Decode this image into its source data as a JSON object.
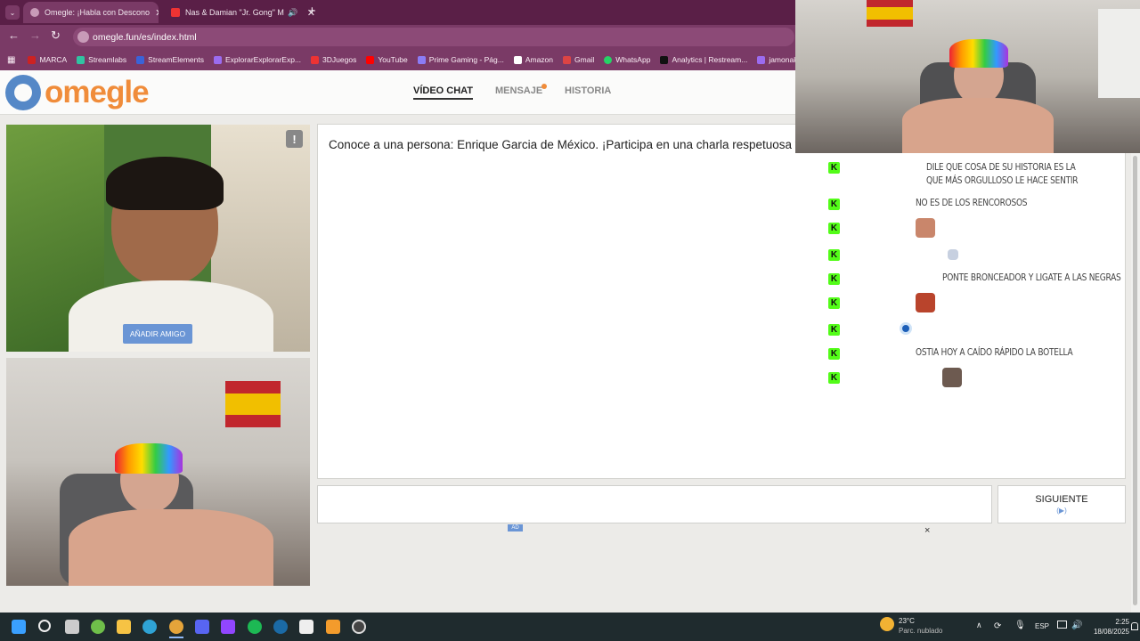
{
  "browser": {
    "tabs": [
      {
        "title": "Omegle: ¡Habla con Descono",
        "active": true
      },
      {
        "title": "Nas & Damian \"Jr. Gong\" M",
        "active": false
      }
    ],
    "url": "omegle.fun/es/index.html",
    "bookmarks": [
      "MARCA",
      "Streamlabs",
      "StreamElements",
      "ExplorarExplorarExp...",
      "3DJuegos",
      "YouTube",
      "Prime Gaming - Pág...",
      "Amazon",
      "Gmail",
      "WhatsApp",
      "Analytics | Restream...",
      "jamonakotv - T"
    ]
  },
  "site": {
    "logo_text": "omegle",
    "nav": [
      "VÍDEO CHAT",
      "MENSAJE",
      "HISTORIA"
    ],
    "add_friend": "AÑADIR AMIGO",
    "report": "!",
    "intro_text": "Conoce a una persona: Enrique Garcia de México. ¡Participa en una charla respetuosa y",
    "next_label": "SIGUIENTE",
    "next_hint": "(▶)",
    "ad_badge": "AD",
    "ad_close": "×"
  },
  "stream_chat": [
    {
      "user": "",
      "message": "DILE QUE COSA DE SU HISTORIA ES LA QUE MÁS ORGULLOSO LE HACE SENTIR"
    },
    {
      "user": "",
      "message": "NO ES DE LOS RENCOROSOS"
    },
    {
      "user": "",
      "message": ""
    },
    {
      "user": "",
      "message": ""
    },
    {
      "user": "",
      "message": "PONTE BRONCEADOR Y LIGATE A LAS NEGRAS"
    },
    {
      "user": "",
      "message": ""
    },
    {
      "user": "",
      "message": ""
    },
    {
      "user": "",
      "message": "OSTIA HOY A CAÍDO RÁPIDO LA BOTELLA"
    },
    {
      "user": "",
      "message": ""
    }
  ],
  "taskbar": {
    "temp": "23°C",
    "condition": "Parc. nublado",
    "lang": "ESP",
    "time": "2:25",
    "date": "18/08/2025"
  },
  "colors": {
    "brand_orange": "#f08c3a",
    "brand_blue": "#5588c7",
    "kick_green": "#53fc18",
    "browser_chrome": "#7a3a66"
  }
}
